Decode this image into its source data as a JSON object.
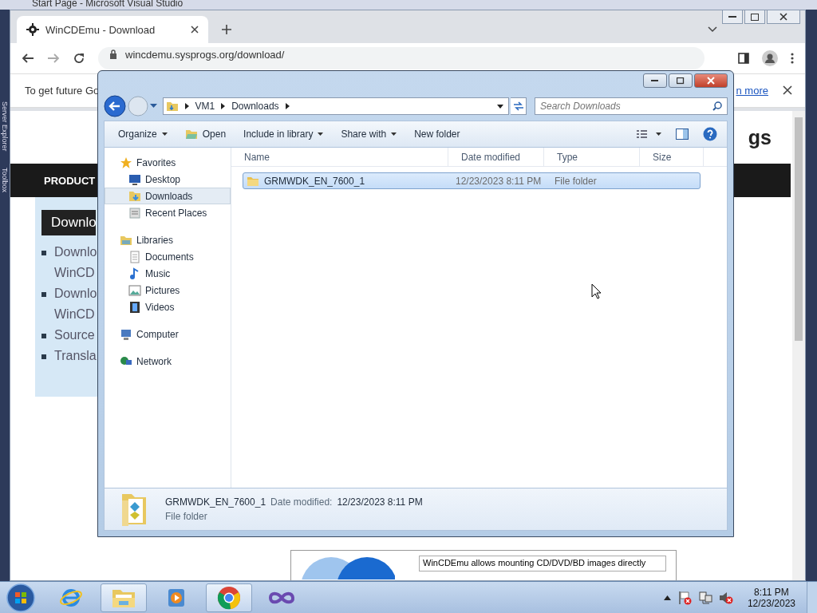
{
  "background_window": {
    "title": "Start Page - Microsoft Visual Studio",
    "side_tabs": [
      "Server Explorer",
      "Toolbox"
    ]
  },
  "browser": {
    "tabs": [
      {
        "title": "WinCDEmu - Download",
        "selected": true
      }
    ],
    "url": "wincdemu.sysprogs.org/download/",
    "infobar": {
      "message": "To get future Go",
      "link": "n more"
    },
    "page": {
      "logo_text": "gs",
      "nav_item": "PRODUCT",
      "sidebar_heading": "Downlo",
      "links": [
        {
          "lines": [
            "Downlo",
            "WinCD"
          ]
        },
        {
          "lines": [
            "Downlo",
            "WinCD"
          ]
        },
        {
          "lines": [
            "Source"
          ]
        },
        {
          "lines": [
            "Transla"
          ]
        }
      ],
      "banner_text": "WinCDEmu allows mounting CD/DVD/BD images directly"
    }
  },
  "explorer": {
    "path": [
      "VM1",
      "Downloads"
    ],
    "search_placeholder": "Search Downloads",
    "toolbar": [
      {
        "label": "Organize",
        "dropdown": true,
        "kind": "plain"
      },
      {
        "label": "Open",
        "dropdown": false,
        "kind": "open"
      },
      {
        "label": "Include in library",
        "dropdown": true,
        "kind": "plain"
      },
      {
        "label": "Share with",
        "dropdown": true,
        "kind": "plain"
      },
      {
        "label": "New folder",
        "dropdown": false,
        "kind": "plain"
      }
    ],
    "nav": [
      {
        "label": "Favorites",
        "kind": "favorites",
        "selected": false,
        "children": [
          {
            "label": "Desktop",
            "kind": "desktop",
            "selected": false
          },
          {
            "label": "Downloads",
            "kind": "downloads",
            "selected": true
          },
          {
            "label": "Recent Places",
            "kind": "recent",
            "selected": false
          }
        ]
      },
      {
        "label": "Libraries",
        "kind": "libraries",
        "selected": false,
        "children": [
          {
            "label": "Documents",
            "kind": "documents",
            "selected": false
          },
          {
            "label": "Music",
            "kind": "music",
            "selected": false
          },
          {
            "label": "Pictures",
            "kind": "pictures",
            "selected": false
          },
          {
            "label": "Videos",
            "kind": "videos",
            "selected": false
          }
        ]
      },
      {
        "label": "Computer",
        "kind": "computer",
        "selected": false
      },
      {
        "label": "Network",
        "kind": "network",
        "selected": false
      }
    ],
    "columns": [
      "Name",
      "Date modified",
      "Type",
      "Size"
    ],
    "files": [
      {
        "name": "GRMWDK_EN_7600_1",
        "date": "12/23/2023 8:11 PM",
        "type": "File folder",
        "selected": true
      }
    ],
    "details": {
      "name": "GRMWDK_EN_7600_1",
      "date_label": "Date modified:",
      "date": "12/23/2023 8:11 PM",
      "type": "File folder"
    }
  },
  "taskbar": {
    "apps": [
      {
        "kind": "ie",
        "active": false
      },
      {
        "kind": "explorer",
        "active": true
      },
      {
        "kind": "media",
        "active": false
      },
      {
        "kind": "chrome",
        "active": true
      },
      {
        "kind": "vs",
        "active": false
      }
    ],
    "time": "8:11 PM",
    "date": "12/23/2023"
  }
}
